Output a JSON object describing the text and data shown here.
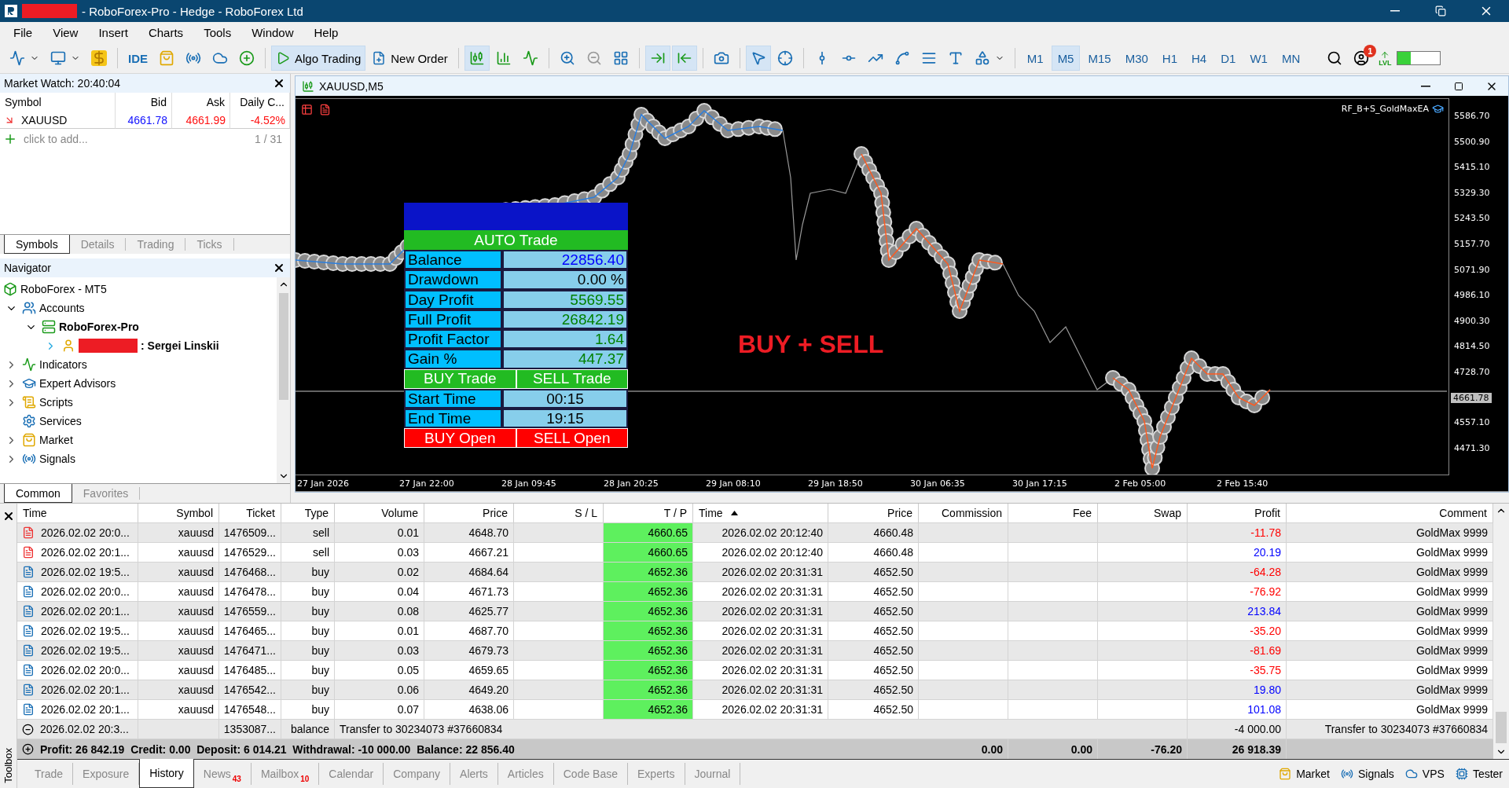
{
  "window": {
    "title": "- RoboForex-Pro - Hedge - RoboForex Ltd"
  },
  "menu": [
    "File",
    "View",
    "Insert",
    "Charts",
    "Tools",
    "Window",
    "Help"
  ],
  "toolbar": {
    "ide_label": "IDE",
    "algo_trading": {
      "label": "Algo Trading",
      "on": true
    },
    "new_order_label": "New Order",
    "chart_types": [
      {
        "selected": true
      },
      {
        "selected": false
      },
      {
        "selected": false
      }
    ],
    "chart_options": [
      {
        "on": true
      },
      {
        "on": true
      }
    ],
    "tools": [
      {
        "selected": true
      },
      {
        "selected": false
      }
    ],
    "timeframes": [
      {
        "label": "M1",
        "selected": false
      },
      {
        "label": "M5",
        "selected": true
      },
      {
        "label": "M15",
        "selected": false
      },
      {
        "label": "M30",
        "selected": false
      },
      {
        "label": "H1",
        "selected": false
      },
      {
        "label": "H4",
        "selected": false
      },
      {
        "label": "D1",
        "selected": false
      },
      {
        "label": "W1",
        "selected": false
      },
      {
        "label": "MN",
        "selected": false
      }
    ],
    "notification_count": "1",
    "level_label": "LVL",
    "level_meter": {
      "level": 0.32
    }
  },
  "market_watch": {
    "title": "Market Watch: 20:40:04",
    "columns": [
      "Symbol",
      "Bid",
      "Ask",
      "Daily C..."
    ],
    "rows": [
      {
        "symbol": "XAUUSD",
        "falling": true,
        "bid": "4661.78",
        "ask": "4661.99",
        "change": "-4.52%"
      }
    ],
    "add_hint": "click to add...",
    "count": "1 / 31",
    "tabs": [
      {
        "label": "Symbols",
        "selected": true
      },
      {
        "label": "Details",
        "selected": false
      },
      {
        "label": "Trading",
        "selected": false
      },
      {
        "label": "Ticks",
        "selected": false
      }
    ]
  },
  "navigator": {
    "title": "Navigator",
    "tree": [
      {
        "label": "RoboForex - MT5",
        "kind": "root",
        "children": [
          {
            "label": "Accounts",
            "kind": "accounts",
            "expanded": true,
            "children": [
              {
                "label": "RoboForex-Pro",
                "kind": "server",
                "expanded": true,
                "children": [
                  {
                    "label": ": Sergei Linskii",
                    "kind": "account",
                    "expanded": false
                  }
                ]
              }
            ]
          },
          {
            "label": "Indicators",
            "kind": "indicators",
            "expanded": false
          },
          {
            "label": "Expert Advisors",
            "kind": "experts",
            "expanded": false
          },
          {
            "label": "Scripts",
            "kind": "scripts",
            "expanded": false
          },
          {
            "label": "Services",
            "kind": "services"
          },
          {
            "label": "Market",
            "kind": "market",
            "expanded": false
          },
          {
            "label": "Signals",
            "kind": "signals",
            "expanded": false
          }
        ]
      }
    ],
    "tabs": [
      {
        "label": "Common",
        "selected": true
      },
      {
        "label": "Favorites",
        "selected": false
      }
    ]
  },
  "chart": {
    "title": "XAUUSD,M5",
    "ea_name": "RF_B+S_GoldMaxEA",
    "price_labels": [
      "5586.70",
      "5500.90",
      "5415.10",
      "5329.30",
      "5243.50",
      "5157.70",
      "5071.90",
      "4986.10",
      "4900.30",
      "4814.50",
      "4728.70",
      "4557.10",
      "4471.30"
    ],
    "current_price": "4661.78",
    "time_labels": [
      "27 Jan 2026",
      "27 Jan 22:00",
      "28 Jan 09:45",
      "28 Jan 20:25",
      "29 Jan 08:10",
      "29 Jan 18:50",
      "30 Jan 06:35",
      "30 Jan 17:15",
      "2 Feb 05:00",
      "2 Feb 15:40"
    ],
    "overlay_text": "BUY + SELL",
    "ea_panel": {
      "mode": "AUTO Trade",
      "stats": [
        {
          "label": "Balance",
          "value": "22856.40",
          "kind": "balance"
        },
        {
          "label": "Drawdown",
          "value": "0.00 %",
          "kind": "neutral"
        },
        {
          "label": "Day Profit",
          "value": "5569.55",
          "kind": "gain"
        },
        {
          "label": "Full Profit",
          "value": "26842.19",
          "kind": "gain"
        },
        {
          "label": "Profit Factor",
          "value": "1.64",
          "kind": "gain"
        },
        {
          "label": "Gain %",
          "value": "447.37",
          "kind": "gain"
        }
      ],
      "trade_buttons": [
        "BUY Trade",
        "SELL Trade"
      ],
      "times": [
        {
          "label": "Start Time",
          "value": "00:15"
        },
        {
          "label": "End Time",
          "value": "19:15"
        }
      ],
      "open_buttons": [
        "BUY Open",
        "SELL Open"
      ]
    }
  },
  "toolbox": {
    "title": "Toolbox",
    "columns": [
      {
        "label": "Time",
        "sorted": false
      },
      {
        "label": "Symbol",
        "sorted": false
      },
      {
        "label": "Ticket",
        "sorted": false
      },
      {
        "label": "Type",
        "sorted": false
      },
      {
        "label": "Volume",
        "sorted": false
      },
      {
        "label": "Price",
        "sorted": false
      },
      {
        "label": "S / L",
        "sorted": false
      },
      {
        "label": "T / P",
        "sorted": false
      },
      {
        "label": "Time",
        "sorted": true
      },
      {
        "label": "Price",
        "sorted": false
      },
      {
        "label": "Commission",
        "sorted": false
      },
      {
        "label": "Fee",
        "sorted": false
      },
      {
        "label": "Swap",
        "sorted": false
      },
      {
        "label": "Profit",
        "sorted": false
      },
      {
        "label": "Comment",
        "sorted": false
      }
    ],
    "rows": [
      {
        "kind": "sell",
        "time": "2026.02.02 20:0...",
        "symbol": "xauusd",
        "ticket": "1476509...",
        "type": "sell",
        "volume": "0.01",
        "price": "4648.70",
        "tp": "4660.65",
        "close_time": "2026.02.02 20:12:40",
        "close_price": "4660.48",
        "profit": "-11.78",
        "loss": true,
        "comment": "GoldMax 9999"
      },
      {
        "kind": "sell",
        "time": "2026.02.02 20:1...",
        "symbol": "xauusd",
        "ticket": "1476529...",
        "type": "sell",
        "volume": "0.03",
        "price": "4667.21",
        "tp": "4660.65",
        "close_time": "2026.02.02 20:12:40",
        "close_price": "4660.48",
        "profit": "20.19",
        "loss": false,
        "comment": "GoldMax 9999"
      },
      {
        "kind": "buy",
        "time": "2026.02.02 19:5...",
        "symbol": "xauusd",
        "ticket": "1476468...",
        "type": "buy",
        "volume": "0.02",
        "price": "4684.64",
        "tp": "4652.36",
        "close_time": "2026.02.02 20:31:31",
        "close_price": "4652.50",
        "profit": "-64.28",
        "loss": true,
        "comment": "GoldMax 9999"
      },
      {
        "kind": "buy",
        "time": "2026.02.02 20:0...",
        "symbol": "xauusd",
        "ticket": "1476478...",
        "type": "buy",
        "volume": "0.04",
        "price": "4671.73",
        "tp": "4652.36",
        "close_time": "2026.02.02 20:31:31",
        "close_price": "4652.50",
        "profit": "-76.92",
        "loss": true,
        "comment": "GoldMax 9999"
      },
      {
        "kind": "buy",
        "time": "2026.02.02 20:1...",
        "symbol": "xauusd",
        "ticket": "1476559...",
        "type": "buy",
        "volume": "0.08",
        "price": "4625.77",
        "tp": "4652.36",
        "close_time": "2026.02.02 20:31:31",
        "close_price": "4652.50",
        "profit": "213.84",
        "loss": false,
        "comment": "GoldMax 9999"
      },
      {
        "kind": "buy",
        "time": "2026.02.02 19:5...",
        "symbol": "xauusd",
        "ticket": "1476465...",
        "type": "buy",
        "volume": "0.01",
        "price": "4687.70",
        "tp": "4652.36",
        "close_time": "2026.02.02 20:31:31",
        "close_price": "4652.50",
        "profit": "-35.20",
        "loss": true,
        "comment": "GoldMax 9999"
      },
      {
        "kind": "buy",
        "time": "2026.02.02 19:5...",
        "symbol": "xauusd",
        "ticket": "1476471...",
        "type": "buy",
        "volume": "0.03",
        "price": "4679.73",
        "tp": "4652.36",
        "close_time": "2026.02.02 20:31:31",
        "close_price": "4652.50",
        "profit": "-81.69",
        "loss": true,
        "comment": "GoldMax 9999"
      },
      {
        "kind": "buy",
        "time": "2026.02.02 20:0...",
        "symbol": "xauusd",
        "ticket": "1476485...",
        "type": "buy",
        "volume": "0.05",
        "price": "4659.65",
        "tp": "4652.36",
        "close_time": "2026.02.02 20:31:31",
        "close_price": "4652.50",
        "profit": "-35.75",
        "loss": true,
        "comment": "GoldMax 9999"
      },
      {
        "kind": "buy",
        "time": "2026.02.02 20:1...",
        "symbol": "xauusd",
        "ticket": "1476542...",
        "type": "buy",
        "volume": "0.06",
        "price": "4649.20",
        "tp": "4652.36",
        "close_time": "2026.02.02 20:31:31",
        "close_price": "4652.50",
        "profit": "19.80",
        "loss": false,
        "comment": "GoldMax 9999"
      },
      {
        "kind": "buy",
        "time": "2026.02.02 20:1...",
        "symbol": "xauusd",
        "ticket": "1476548...",
        "type": "buy",
        "volume": "0.07",
        "price": "4638.06",
        "tp": "4652.36",
        "close_time": "2026.02.02 20:31:31",
        "close_price": "4652.50",
        "profit": "101.08",
        "loss": false,
        "comment": "GoldMax 9999"
      },
      {
        "kind": "balance",
        "time": "2026.02.02 20:3...",
        "ticket": "1353087...",
        "type": "balance",
        "description": "Transfer to 30234073 #37660834",
        "profit": "-4 000.00",
        "comment": "Transfer to 30234073 #37660834"
      }
    ],
    "summary": {
      "text": "Profit: 26 842.19  Credit: 0.00  Deposit: 6 014.21  Withdrawal: -10 000.00  Balance: 22 856.40",
      "commission": "0.00",
      "fee": "0.00",
      "swap": "-76.20",
      "profit": "26 918.39"
    },
    "tabs": [
      {
        "label": "Trade",
        "selected": false
      },
      {
        "label": "Exposure",
        "selected": false
      },
      {
        "label": "History",
        "selected": true
      },
      {
        "label": "News",
        "badge": "43",
        "selected": false
      },
      {
        "label": "Mailbox",
        "badge": "10",
        "selected": false
      },
      {
        "label": "Calendar",
        "selected": false
      },
      {
        "label": "Company",
        "selected": false
      },
      {
        "label": "Alerts",
        "selected": false
      },
      {
        "label": "Articles",
        "selected": false
      },
      {
        "label": "Code Base",
        "selected": false
      },
      {
        "label": "Experts",
        "selected": false
      },
      {
        "label": "Journal",
        "selected": false
      }
    ],
    "services": [
      {
        "label": "Market",
        "kind": "market"
      },
      {
        "label": "Signals",
        "kind": "signals"
      },
      {
        "label": "VPS",
        "kind": "vps"
      },
      {
        "label": "Tester",
        "kind": "tester"
      }
    ]
  }
}
